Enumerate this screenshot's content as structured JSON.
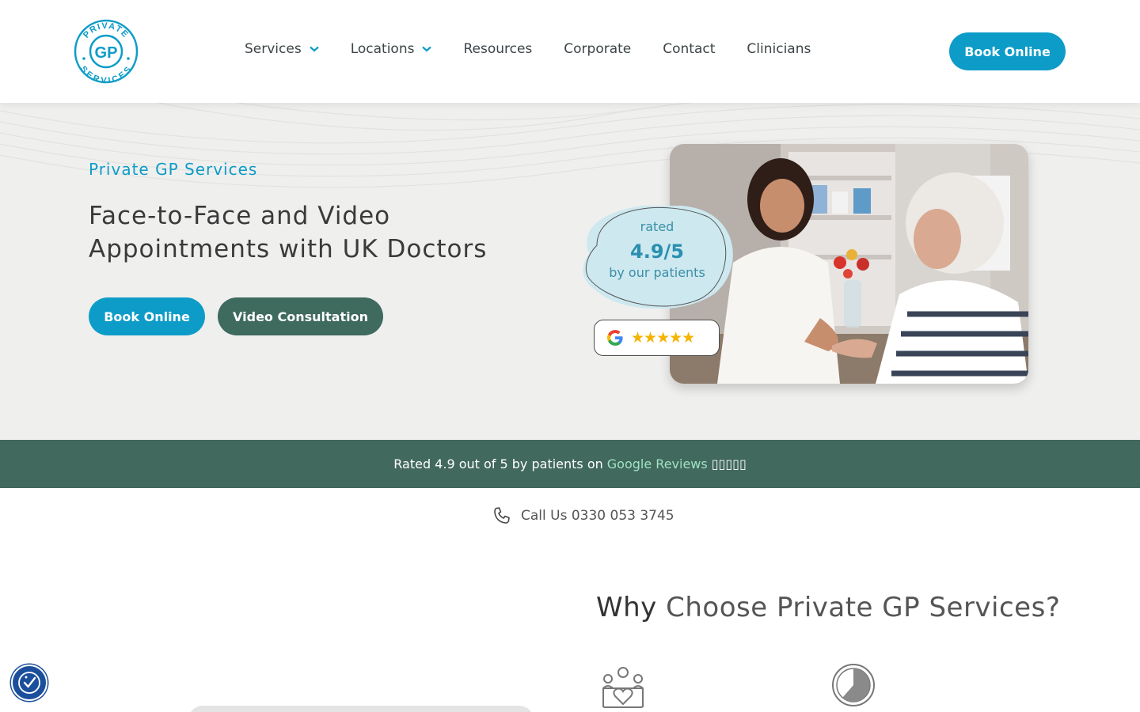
{
  "header": {
    "logo": {
      "top_text": "PRIVATE",
      "center_text": "GP",
      "bottom_text": "SERVICES",
      "icon": "gp-logo"
    },
    "nav": [
      {
        "label": "Services",
        "has_dropdown": true
      },
      {
        "label": "Locations",
        "has_dropdown": true
      },
      {
        "label": "Resources",
        "has_dropdown": false
      },
      {
        "label": "Corporate",
        "has_dropdown": false
      },
      {
        "label": "Contact",
        "has_dropdown": false
      },
      {
        "label": "Clinicians",
        "has_dropdown": false
      }
    ],
    "book_label": "Book Online"
  },
  "hero": {
    "eyebrow": "Private GP Services",
    "title": "Face-to-Face and Video Appointments with UK Doctors",
    "book_label": "Book Online",
    "video_label": "Video Consultation",
    "rating": {
      "rated": "rated",
      "score": "4.9/5",
      "by": "by our patients"
    },
    "google_badge": {
      "icon": "google-g-icon",
      "stars": "★★★★★",
      "star_count": 5
    }
  },
  "strip": {
    "text": "Rated 4.9 out of 5 by patients on",
    "link": "Google Reviews",
    "boxes": "▯▯▯▯▯"
  },
  "call": {
    "icon": "phone-icon",
    "label": "Call Us 0330 053 3745"
  },
  "why": {
    "strong": "Why",
    "rest": "Choose Private GP Services?"
  },
  "colors": {
    "brand_blue": "#0d9cc8",
    "brand_green": "#42695d",
    "button_green": "#3f6a5e"
  },
  "accessibility": {
    "icon": "accessibility-icon"
  }
}
